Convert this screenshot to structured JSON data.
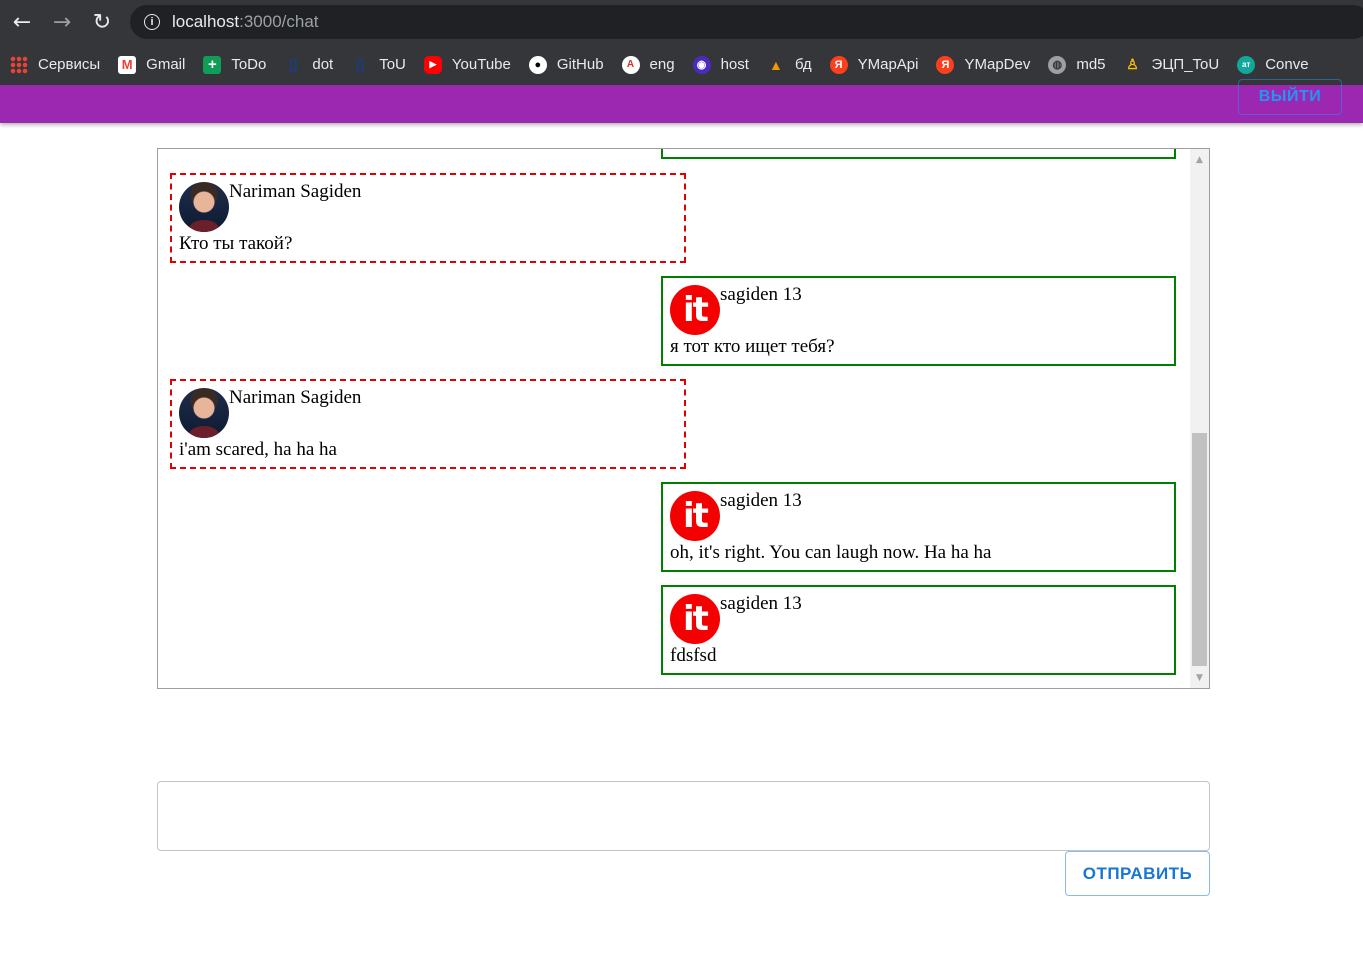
{
  "browser": {
    "url_host": "localhost",
    "url_path": ":3000/chat",
    "bookmarks": [
      {
        "label": "Сервисы",
        "icon": "apps-icon"
      },
      {
        "label": "Gmail",
        "icon": "gmail-icon"
      },
      {
        "label": "ToDo",
        "icon": "todo-icon"
      },
      {
        "label": "dot",
        "icon": "dot-icon"
      },
      {
        "label": "ToU",
        "icon": "tou-icon"
      },
      {
        "label": "YouTube",
        "icon": "youtube-icon"
      },
      {
        "label": "GitHub",
        "icon": "github-icon"
      },
      {
        "label": "eng",
        "icon": "translate-icon"
      },
      {
        "label": "host",
        "icon": "host-icon"
      },
      {
        "label": "бд",
        "icon": "database-icon"
      },
      {
        "label": "YMapApi",
        "icon": "yandex-icon"
      },
      {
        "label": "YMapDev",
        "icon": "yandex-icon"
      },
      {
        "label": "md5",
        "icon": "globe-icon"
      },
      {
        "label": "ЭЦП_ToU",
        "icon": "rocket-icon"
      },
      {
        "label": "Conve",
        "icon": "convert-icon"
      }
    ]
  },
  "appbar": {
    "logout_label": "ВЫЙТИ",
    "color": "#9c27b0"
  },
  "chat": {
    "messages": [
      {
        "author": "Nariman Sagiden",
        "text": "Кто ты такой?",
        "side": "other",
        "avatar": "person-avatar"
      },
      {
        "author": "sagiden 13",
        "text": "я тот кто ищет тебя?",
        "side": "mine",
        "avatar": "it-logo-avatar"
      },
      {
        "author": "Nariman Sagiden",
        "text": "i'am scared, ha ha ha",
        "side": "other",
        "avatar": "person-avatar"
      },
      {
        "author": "sagiden 13",
        "text": "oh, it's right. You can laugh now. Ha ha ha",
        "side": "mine",
        "avatar": "it-logo-avatar"
      },
      {
        "author": "sagiden 13",
        "text": "fdsfsd",
        "side": "mine",
        "avatar": "it-logo-avatar"
      }
    ],
    "avatar_it_text": "it"
  },
  "composer": {
    "value": "",
    "send_label": "ОТПРАВИТЬ"
  },
  "colors": {
    "other_border": "#e00000",
    "mine_border": "#008000",
    "button_blue": "#1976d2"
  }
}
